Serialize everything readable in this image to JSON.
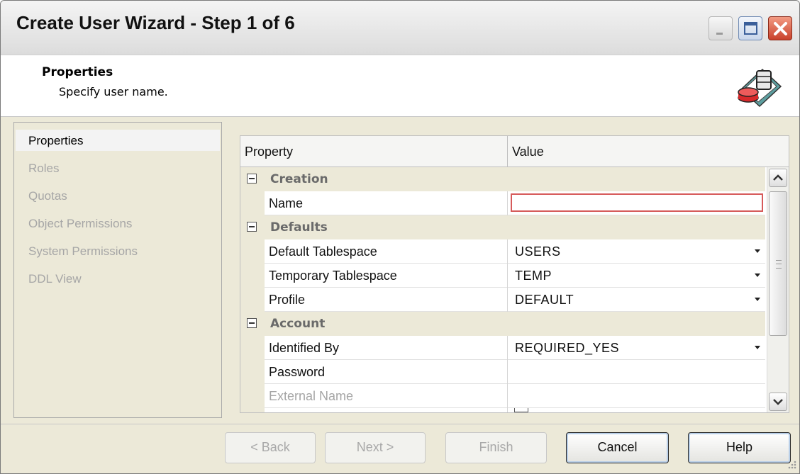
{
  "window": {
    "title": "Create User Wizard - Step 1 of 6"
  },
  "header": {
    "title": "Properties",
    "subtitle": "Specify user name.",
    "icon": "database-user-icon"
  },
  "sidebar": {
    "items": [
      {
        "label": "Properties",
        "active": true
      },
      {
        "label": "Roles",
        "active": false
      },
      {
        "label": "Quotas",
        "active": false
      },
      {
        "label": "Object Permissions",
        "active": false
      },
      {
        "label": "System Permissions",
        "active": false
      },
      {
        "label": "DDL View",
        "active": false
      }
    ]
  },
  "grid": {
    "columns": {
      "property": "Property",
      "value": "Value"
    },
    "categories": {
      "creation": "Creation",
      "defaults": "Defaults",
      "account": "Account"
    },
    "rows": {
      "name": {
        "label": "Name",
        "value": ""
      },
      "default_tablespace": {
        "label": "Default Tablespace",
        "value": "USERS"
      },
      "temporary_tablespace": {
        "label": "Temporary Tablespace",
        "value": "TEMP"
      },
      "profile": {
        "label": "Profile",
        "value": "DEFAULT"
      },
      "identified_by": {
        "label": "Identified By",
        "value": "REQUIRED_YES"
      },
      "password": {
        "label": "Password",
        "value": ""
      },
      "external_name": {
        "label": "External Name",
        "value": ""
      }
    }
  },
  "buttons": {
    "back": "< Back",
    "next": "Next >",
    "finish": "Finish",
    "cancel": "Cancel",
    "help": "Help"
  },
  "colors": {
    "invalid_border": "#d65a5a",
    "close_button": "#c9422c"
  }
}
